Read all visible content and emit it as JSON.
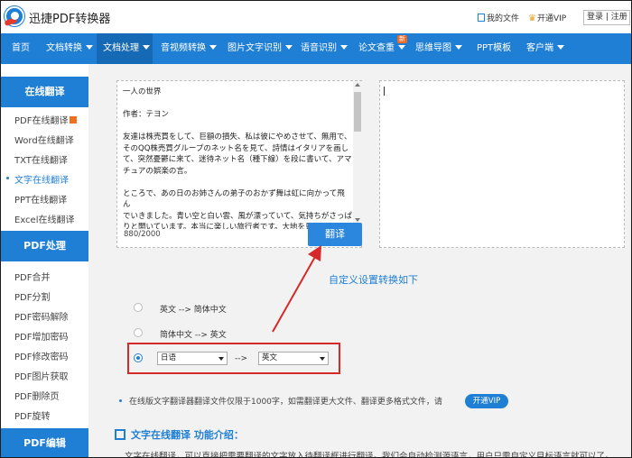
{
  "app": {
    "title": "迅捷PDF转换器"
  },
  "topbar": {
    "my_files": "我的文件",
    "vip": "开通VIP",
    "login": "登录 | 注册"
  },
  "nav": {
    "items": [
      "首页",
      "文档转换",
      "文档处理",
      "音视频转换",
      "图片文字识别",
      "语音识别",
      "论文查重",
      "思维导图",
      "PPT模板",
      "客户端"
    ],
    "new_badge": "新",
    "active": "文档处理"
  },
  "sidebar": {
    "section1": "在线翻译",
    "items1": [
      "PDF在线翻译",
      "Word在线翻译",
      "TXT在线翻译",
      "文字在线翻译",
      "PPT在线翻译",
      "Excel在线翻译"
    ],
    "section2": "PDF处理",
    "items2": [
      "PDF合并",
      "PDF分割",
      "PDF密码解除",
      "PDF增加密码",
      "PDF修改密码",
      "PDF图片获取",
      "PDF删除页",
      "PDF旋转"
    ],
    "section3": "PDF编辑"
  },
  "source": {
    "text": "一人の世界\n\n作者：テヨン\n\n友達は株売買をして、巨額の損失、私は彼にやめさせて、無用で、\nそのQQ株売買グループのネット名を見て、詩情はイタリアを画し\nて、突然憂鬱に来て、迷待ネット名（種下線）を段に書いて、アマ\nチュアの娯楽の言。\n\nところで、あの日のお姉さんの弟子のおかず舞は虹に向かって飛ん\nでいきました。青い空と白い雲、風が漂っていて、気持ちがさっぱ\nりと開いています。本当に楽しい旅行者です。大地を見下ろしま\nす。東見路の両側には黄揺樹、ポプラの木、歯砂糖のオリーブ、レ\nモンのお茶などがあります。子供の心を持っている黄品さんを見ま",
    "counter": "880/2000",
    "translate_button": "翻译"
  },
  "options": {
    "title": "自定义设置转换如下",
    "opt1": "英文 --> 简体中文",
    "opt2": "简体中文 --> 英文",
    "from_lang": "日语",
    "arrow": "-->",
    "to_lang": "英文",
    "selected": 3
  },
  "notice": {
    "text": "在线版文字翻译器翻译文件仅限于1000字，如需翻译更大文件、翻译更多格式文件，请",
    "vip_button": "开通VIP"
  },
  "intro": {
    "title": "文字在线翻译 功能介绍：",
    "text": "文字在线翻译，可以直接把需要翻译的文字放入待翻译框进行翻译。我们会自动检测源语言，用户只需自定义目标语言就可以了。"
  },
  "colors": {
    "brand": "#1f7fd4",
    "highlight": "#d62a2a",
    "nav_active": "#1669b5"
  }
}
